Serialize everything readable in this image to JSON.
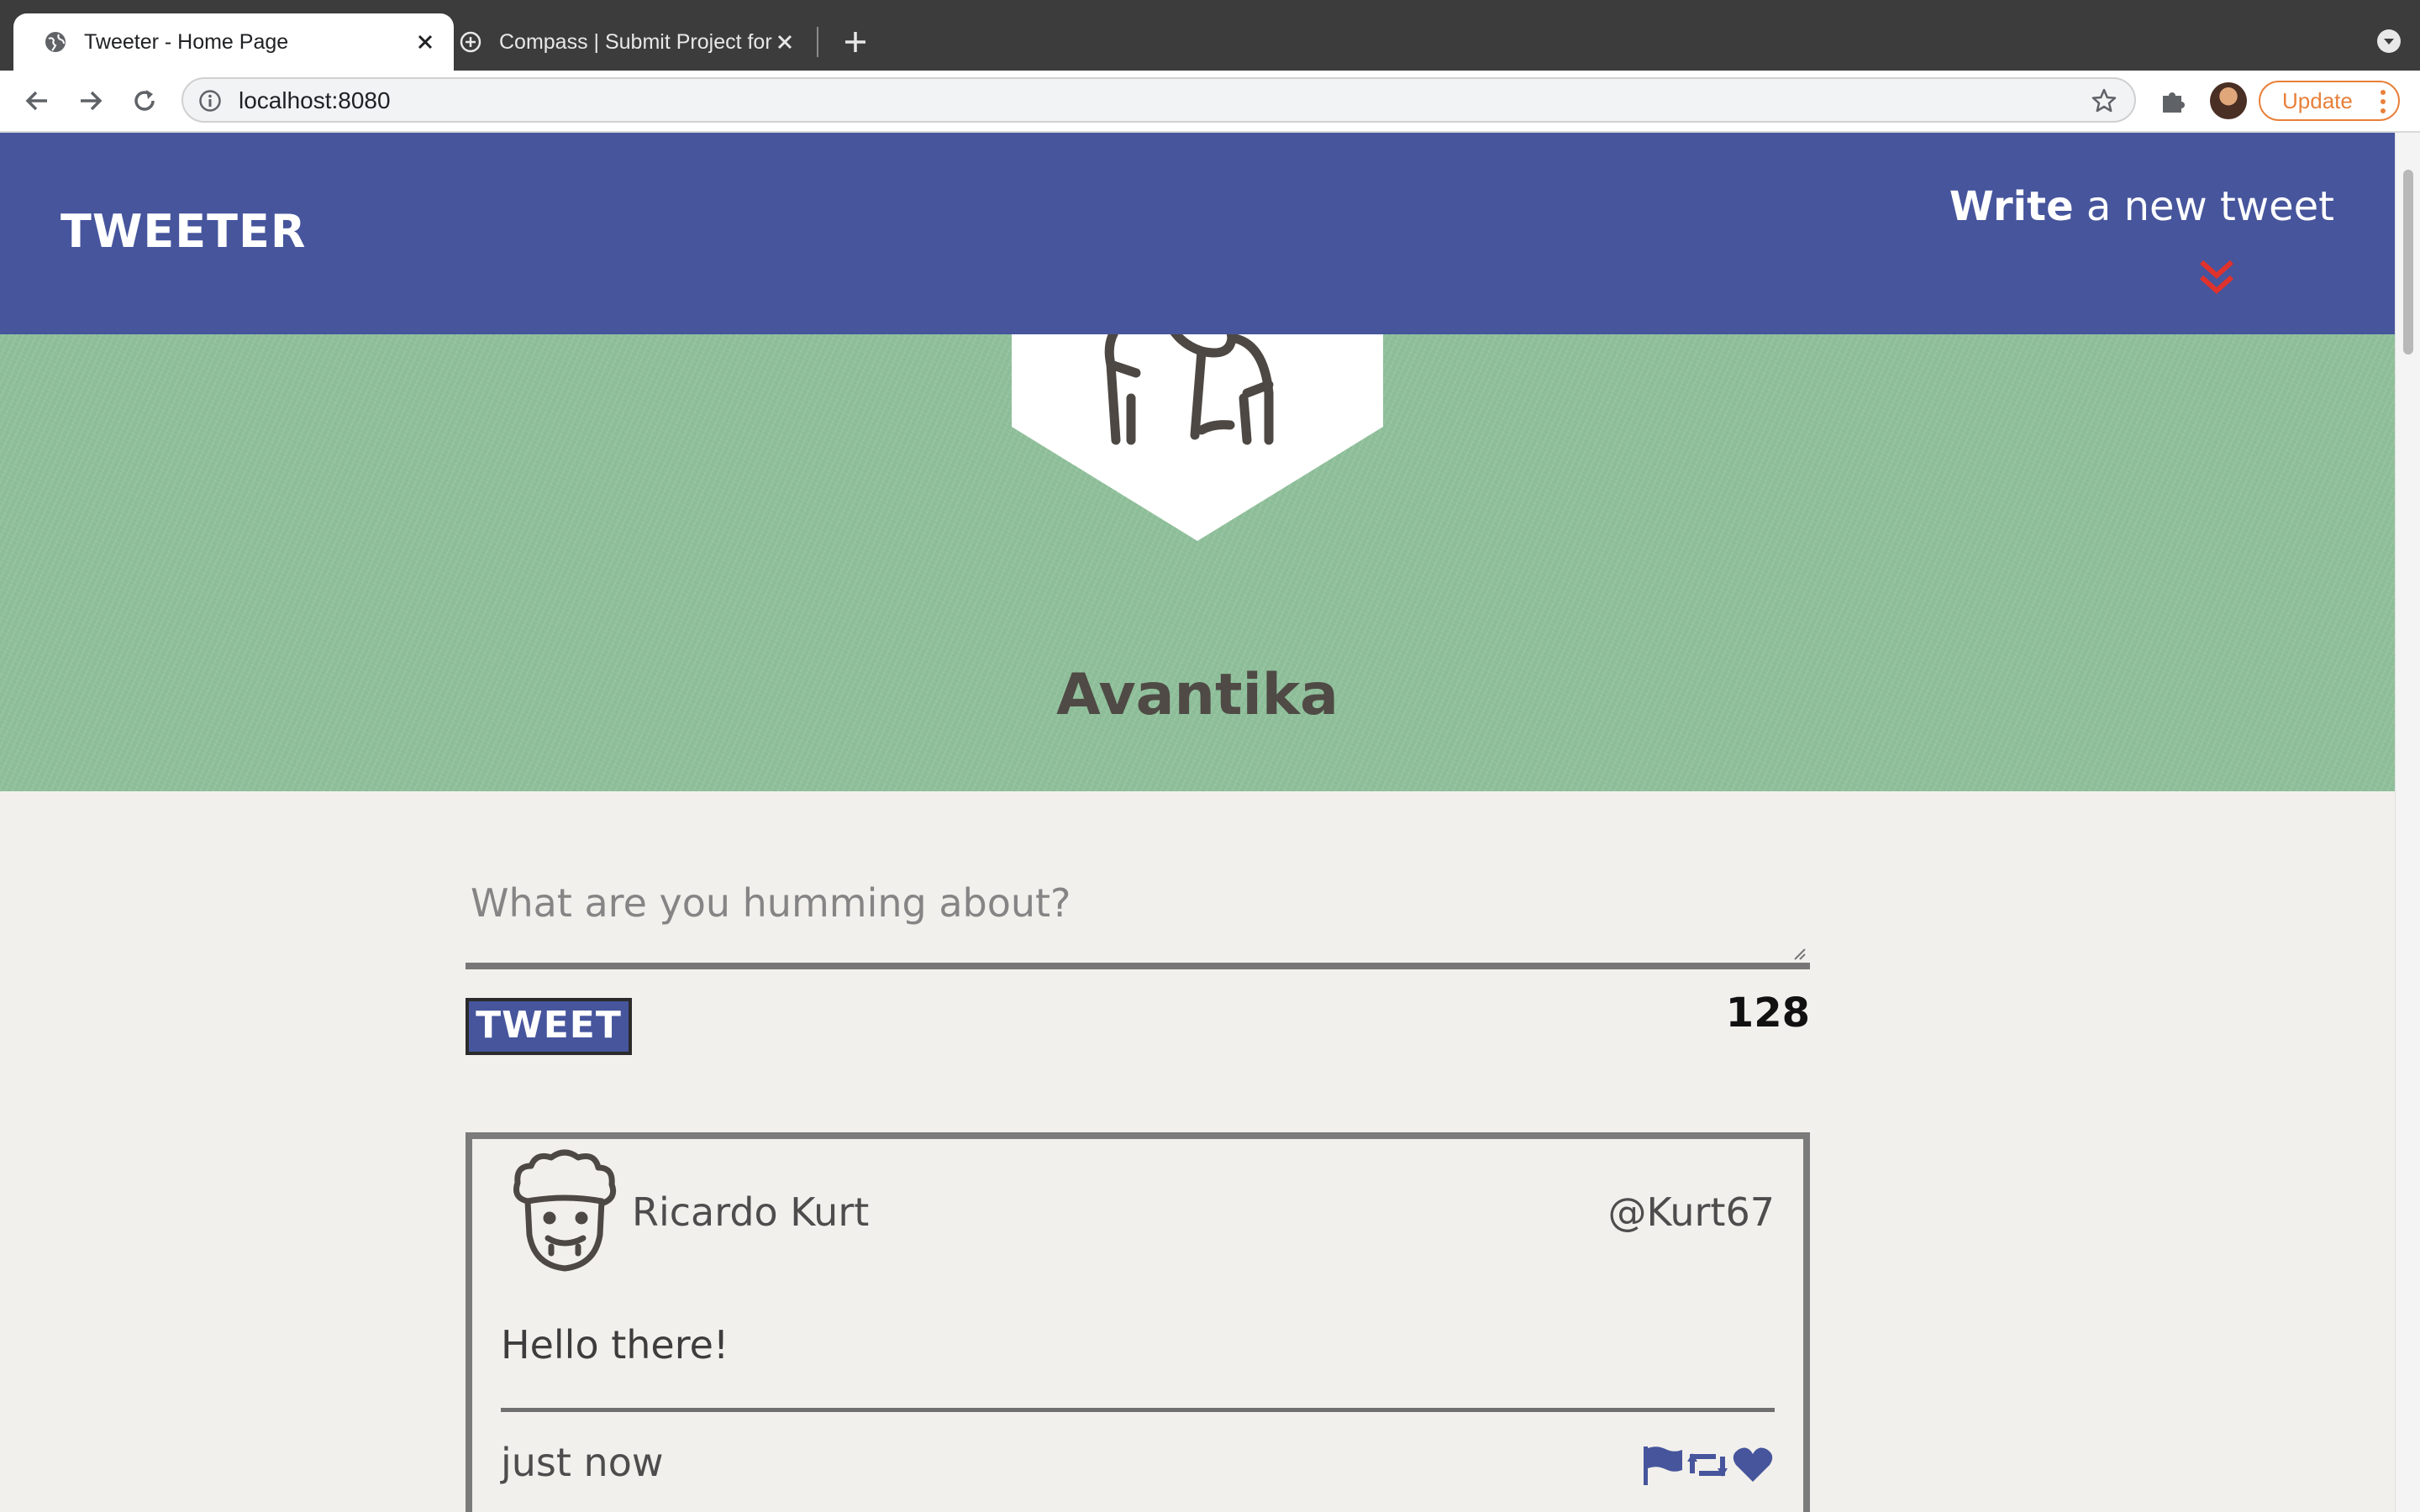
{
  "browser": {
    "tabs": [
      {
        "title": "Tweeter - Home Page",
        "active": true
      },
      {
        "title": "Compass | Submit Project for E",
        "active": false
      }
    ],
    "url": "localhost:8080",
    "update_label": "Update"
  },
  "nav": {
    "brand": "TWEETER",
    "write_bold": "Write",
    "write_rest": " a new tweet"
  },
  "profile": {
    "name": "Avantika"
  },
  "composer": {
    "placeholder": "What are you humming about?",
    "tweet_button": "TWEET",
    "char_count": "128"
  },
  "tweets": [
    {
      "name": "Ricardo Kurt",
      "handle": "@Kurt67",
      "text": "Hello there!",
      "time": "just now"
    }
  ],
  "colors": {
    "nav_bg": "#46559c",
    "hero_bg": "#8fbf9a",
    "accent_red": "#e0322c",
    "page_bg": "#f2f0ec"
  }
}
